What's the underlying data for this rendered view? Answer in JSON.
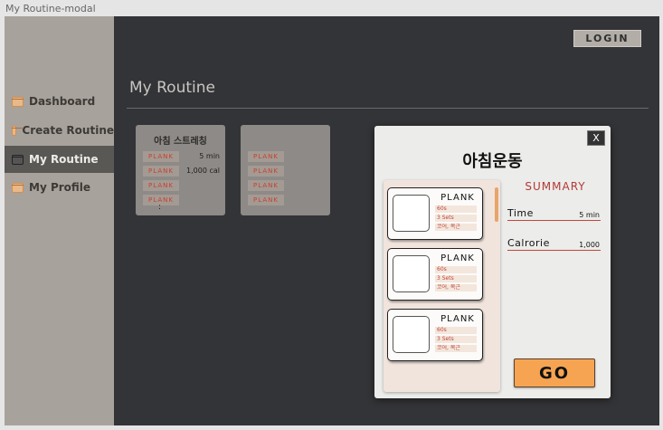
{
  "window": {
    "title": "My Routine-modal"
  },
  "sidebar": {
    "items": [
      {
        "label": "Dashboard",
        "icon": "folder-icon",
        "active": false
      },
      {
        "label": "Create Routine",
        "icon": "folder-icon",
        "active": false
      },
      {
        "label": "My Routine",
        "icon": "folder-icon",
        "active": true
      },
      {
        "label": "My Profile",
        "icon": "folder-icon",
        "active": false
      }
    ]
  },
  "header": {
    "login_label": "LOGIN"
  },
  "page": {
    "title": "My Routine"
  },
  "routine_cards": [
    {
      "title": "아침 스트레칭",
      "exercises": [
        "PLANK",
        "PLANK",
        "PLANK",
        "PLANK"
      ],
      "time": "5 min",
      "calories": "1,000 cal",
      "more": ":"
    },
    {
      "title": "",
      "exercises": [
        "PLANK",
        "PLANK",
        "PLANK",
        "PLANK"
      ],
      "time": "",
      "calories": "",
      "more": ""
    }
  ],
  "modal": {
    "title": "아침운동",
    "close_label": "X",
    "exercises": [
      {
        "name": "PLANK",
        "duration": "60s",
        "sets": "3 Sets",
        "target": "코어, 복근"
      },
      {
        "name": "PLANK",
        "duration": "60s",
        "sets": "3 Sets",
        "target": "코어, 복근"
      },
      {
        "name": "PLANK",
        "duration": "60s",
        "sets": "3 Sets",
        "target": "코어, 복근"
      }
    ],
    "summary": {
      "title": "SUMMARY",
      "time_label": "Time",
      "time_value": "5 min",
      "calorie_label": "Calrorie",
      "calorie_value": "1,000"
    },
    "go_label": "GO"
  },
  "colors": {
    "accent": "#f6a452",
    "summary_red": "#b23a36",
    "sidebar_bg": "#a8a29c",
    "main_bg": "#333437"
  }
}
